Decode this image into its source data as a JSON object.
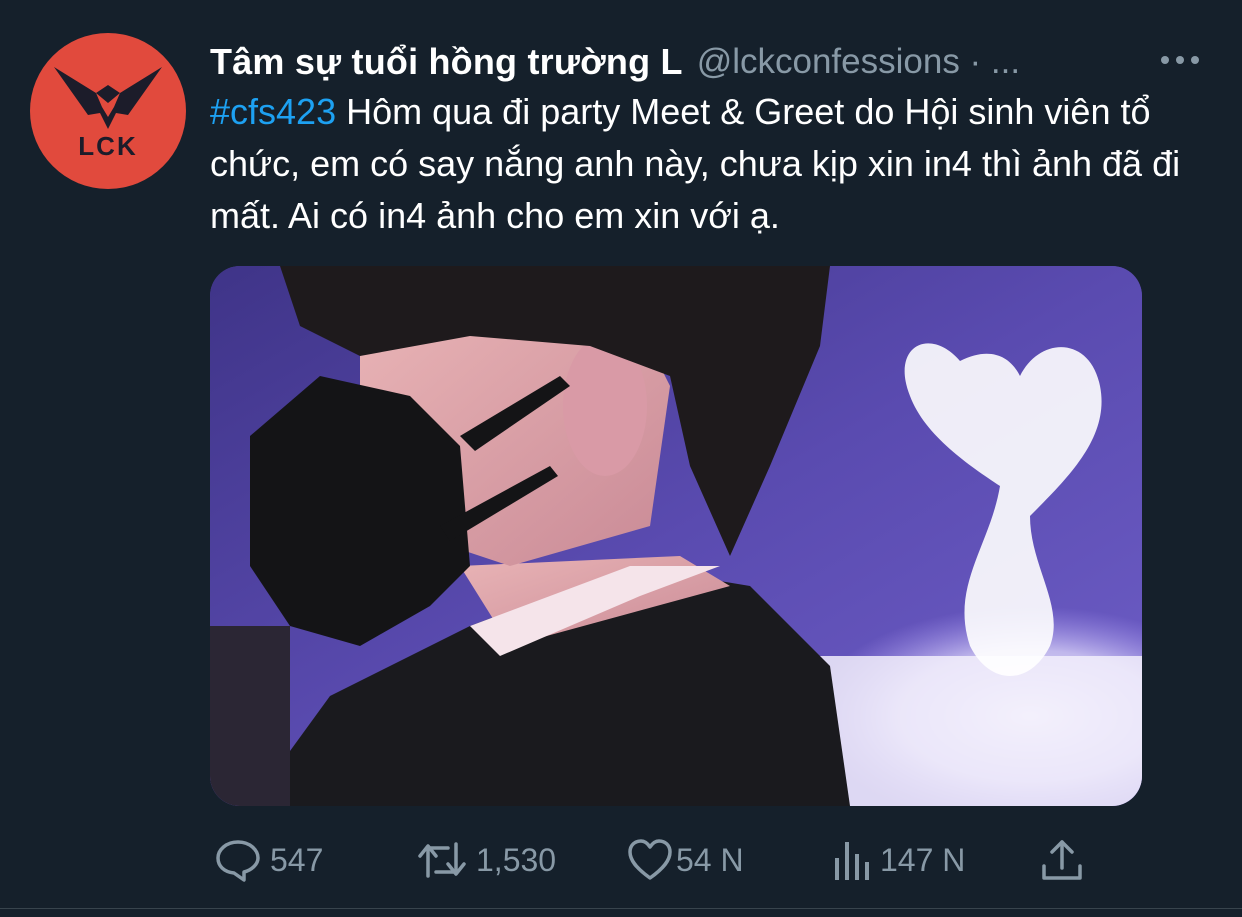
{
  "tweet": {
    "display_name": "Tâm sự tuổi hồng trường L",
    "handle": "@lckconfessions · ...",
    "hashtag": "#cfs423",
    "text": " Hôm qua đi party Meet & Greet do Hội sinh viên tổ chức, em có say nắng anh này, chưa kịp xin in4 thì ảnh đã đi mất. Ai có in4 ảnh cho em xin với ạ.",
    "avatar_text": "LCK"
  },
  "actions": {
    "reply_count": "547",
    "retweet_count": "1,530",
    "like_count": "54 N",
    "views_count": "147 N"
  },
  "icons": {
    "more": "more-horizontal-icon",
    "reply": "speech-bubble-icon",
    "retweet": "retweet-arrows-icon",
    "like": "heart-icon",
    "views": "bar-chart-icon",
    "share": "share-upload-icon"
  },
  "colors": {
    "background": "#15202b",
    "accent": "#1da1f2",
    "muted": "#8899a6",
    "avatar_bg": "#e14a3d"
  }
}
